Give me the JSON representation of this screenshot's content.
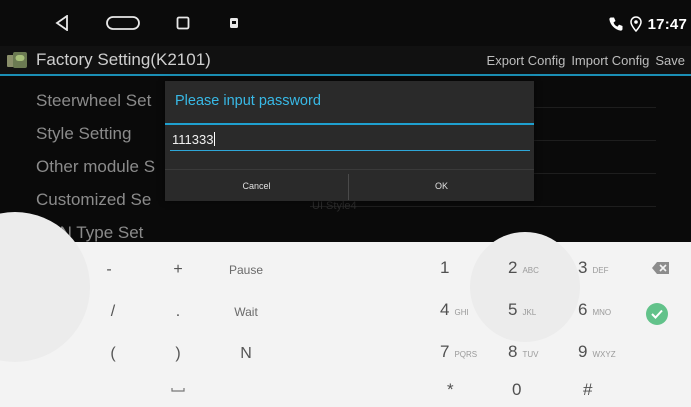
{
  "status_bar": {
    "nav_icons": [
      "back-icon",
      "home-icon",
      "recent-apps-icon",
      "app-icon"
    ],
    "phone_icon": "phone-icon",
    "location_icon": "location-icon",
    "time": "17:47"
  },
  "app_bar": {
    "title": "Factory Setting(K2101)",
    "actions": [
      "Export Config",
      "Import Config",
      "Save"
    ]
  },
  "settings": {
    "items": [
      "Steerwheel Set",
      "Style Setting",
      "Other module S",
      "Customized Se",
      "CAN Type Set"
    ],
    "value_style": "UI Style4"
  },
  "dialog": {
    "title": "Please input password",
    "input_value": "111333",
    "cancel_label": "Cancel",
    "ok_label": "OK"
  },
  "keypad": {
    "symbols": [
      [
        "-",
        "+",
        "Pause"
      ],
      [
        "/",
        ".",
        "Wait"
      ],
      [
        "(",
        ")",
        "N"
      ],
      [
        "",
        "",
        ""
      ]
    ],
    "numbers": [
      {
        "digit": "1",
        "letters": ""
      },
      {
        "digit": "2",
        "letters": "ABC"
      },
      {
        "digit": "3",
        "letters": "DEF"
      },
      {
        "digit": "4",
        "letters": "GHI"
      },
      {
        "digit": "5",
        "letters": "JKL"
      },
      {
        "digit": "6",
        "letters": "MNO"
      },
      {
        "digit": "7",
        "letters": "PQRS"
      },
      {
        "digit": "8",
        "letters": "TUV"
      },
      {
        "digit": "9",
        "letters": "WXYZ"
      },
      {
        "digit": "*",
        "letters": ""
      },
      {
        "digit": "0",
        "letters": ""
      },
      {
        "digit": "#",
        "letters": ""
      }
    ],
    "space_icon": "space-icon",
    "backspace_icon": "backspace-icon",
    "done_icon": "check-icon"
  }
}
